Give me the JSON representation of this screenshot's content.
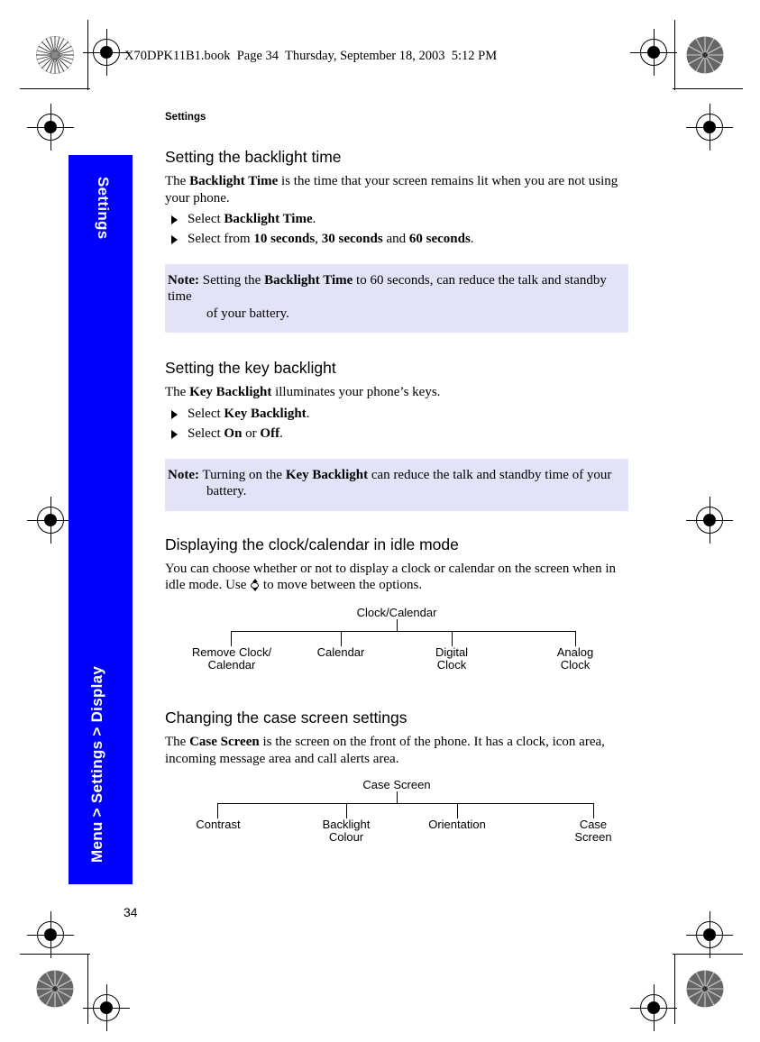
{
  "document": {
    "book_header": "X70DPK11B1.book  Page 34  Thursday, September 18, 2003  5:12 PM",
    "running_title": "Settings",
    "page_number": "34",
    "accent_blue": "#0000FF",
    "note_background": "#E3E3F8"
  },
  "side_tab": {
    "chapter_label": "Settings",
    "path_label": "Menu > Settings > Display"
  },
  "sections": [
    {
      "heading": "Setting the backlight time",
      "intro_parts": [
        {
          "text": "The ",
          "bold": false
        },
        {
          "text": "Backlight Time",
          "bold": true
        },
        {
          "text": " is the time that your screen remains lit when you are not using your phone.",
          "bold": false
        }
      ],
      "bullets": [
        [
          {
            "text": "Select ",
            "bold": false
          },
          {
            "text": "Backlight Time",
            "bold": true
          },
          {
            "text": ".",
            "bold": false
          }
        ],
        [
          {
            "text": "Select from ",
            "bold": false
          },
          {
            "text": "10 seconds",
            "bold": true
          },
          {
            "text": ", ",
            "bold": false
          },
          {
            "text": "30 seconds",
            "bold": true
          },
          {
            "text": " and ",
            "bold": false
          },
          {
            "text": "60 seconds",
            "bold": true
          },
          {
            "text": ".",
            "bold": false
          }
        ]
      ],
      "note": {
        "label": "Note:",
        "line1_parts": [
          {
            "text": " Setting the ",
            "bold": false
          },
          {
            "text": "Backlight Time",
            "bold": true
          },
          {
            "text": " to 60 seconds, can reduce the talk and standby time",
            "bold": false
          }
        ],
        "line2": "of your battery."
      }
    },
    {
      "heading": "Setting the key backlight",
      "intro_parts": [
        {
          "text": "The ",
          "bold": false
        },
        {
          "text": "Key Backlight",
          "bold": true
        },
        {
          "text": " illuminates your phone’s keys.",
          "bold": false
        }
      ],
      "bullets": [
        [
          {
            "text": "Select ",
            "bold": false
          },
          {
            "text": "Key Backlight",
            "bold": true
          },
          {
            "text": ".",
            "bold": false
          }
        ],
        [
          {
            "text": "Select ",
            "bold": false
          },
          {
            "text": "On",
            "bold": true
          },
          {
            "text": " or ",
            "bold": false
          },
          {
            "text": "Off",
            "bold": true
          },
          {
            "text": ".",
            "bold": false
          }
        ]
      ],
      "note": {
        "label": "Note:",
        "line1_parts": [
          {
            "text": " Turning on the ",
            "bold": false
          },
          {
            "text": "Key Backlight",
            "bold": true
          },
          {
            "text": " can reduce the talk and standby time of your",
            "bold": false
          }
        ],
        "line2": "battery."
      }
    },
    {
      "heading": "Displaying the clock/calendar in idle mode",
      "intro_parts": [
        {
          "text": "You can choose whether or not to display a clock or calendar on the screen when in idle mode. Use ",
          "bold": false
        },
        {
          "icon": "navigation-key-icon"
        },
        {
          "text": " to move between the options.",
          "bold": false
        }
      ]
    },
    {
      "heading": "Changing the case screen settings",
      "intro_parts": [
        {
          "text": "The ",
          "bold": false
        },
        {
          "text": "Case Screen",
          "bold": true
        },
        {
          "text": " is the screen on the front of the phone. It has a clock, icon area, incoming message area and call alerts area.",
          "bold": false
        }
      ]
    }
  ],
  "trees": [
    {
      "root": "Clock/Calendar",
      "leaves": [
        "Remove Clock/\nCalendar",
        "Calendar",
        "Digital\nClock",
        "Analog\nClock"
      ]
    },
    {
      "root": "Case Screen",
      "leaves": [
        "Contrast",
        "Backlight\nColour",
        "Orientation",
        "Case\nScreen"
      ]
    }
  ]
}
